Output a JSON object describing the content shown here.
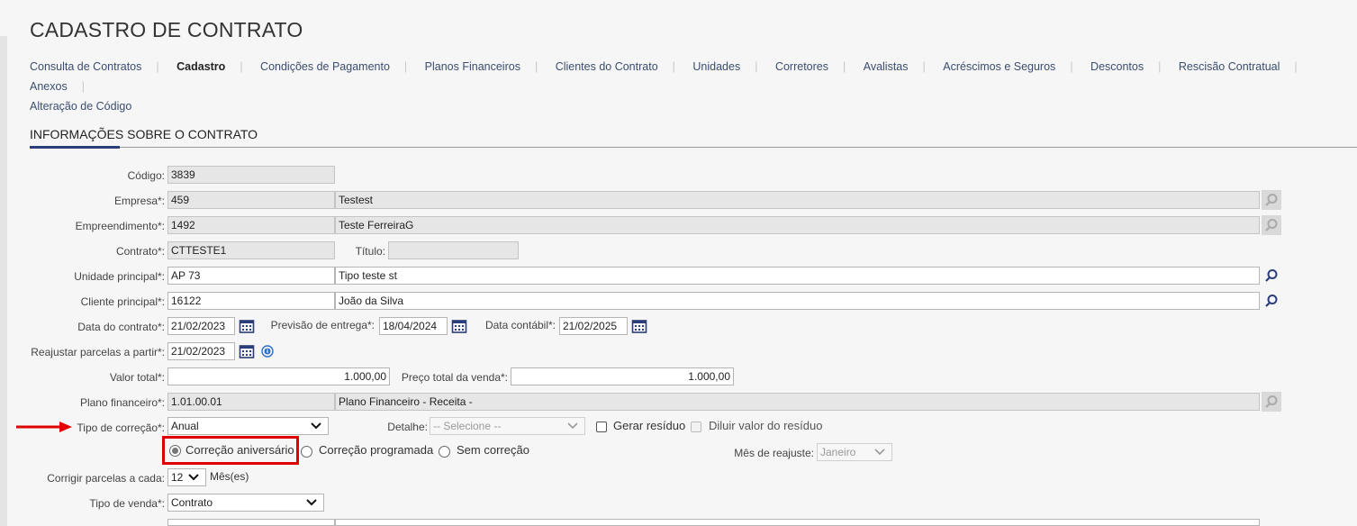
{
  "page": {
    "title": "CADASTRO DE CONTRATO"
  },
  "tabs": [
    {
      "label": "Consulta de Contratos",
      "active": false
    },
    {
      "label": "Cadastro",
      "active": true
    },
    {
      "label": "Condições de Pagamento",
      "active": false
    },
    {
      "label": "Planos Financeiros",
      "active": false
    },
    {
      "label": "Clientes do Contrato",
      "active": false
    },
    {
      "label": "Unidades",
      "active": false
    },
    {
      "label": "Corretores",
      "active": false
    },
    {
      "label": "Avalistas",
      "active": false
    },
    {
      "label": "Acréscimos e Seguros",
      "active": false
    },
    {
      "label": "Descontos",
      "active": false
    },
    {
      "label": "Rescisão Contratual",
      "active": false
    },
    {
      "label": "Anexos",
      "active": false
    },
    {
      "label": "Alteração de Código",
      "active": false
    }
  ],
  "section": {
    "title": "INFORMAÇÕES SOBRE O CONTRATO"
  },
  "form": {
    "codigo": {
      "label": "Código:",
      "value": "3839"
    },
    "empresa": {
      "label": "Empresa*:",
      "code": "459",
      "name": "Testest"
    },
    "empreendimento": {
      "label": "Empreendimento*:",
      "code": "1492",
      "name": "Teste FerreiraG"
    },
    "contrato": {
      "label": "Contrato*:",
      "value": "CTTESTE1"
    },
    "titulo": {
      "label": "Título:",
      "value": ""
    },
    "unidade": {
      "label": "Unidade principal*:",
      "code": "AP 73",
      "name": "Tipo teste st"
    },
    "cliente": {
      "label": "Cliente principal*:",
      "code": "16122",
      "name": "João da Silva"
    },
    "data_contrato": {
      "label": "Data do contrato*:",
      "value": "21/02/2023"
    },
    "previsao_entrega": {
      "label": "Previsão de entrega*:",
      "value": "18/04/2024"
    },
    "data_contabil": {
      "label": "Data contábil*:",
      "value": "21/02/2025"
    },
    "reajustar": {
      "label": "Reajustar parcelas a partir*:",
      "value": "21/02/2023"
    },
    "valor_total": {
      "label": "Valor total*:",
      "value": "1.000,00"
    },
    "preco_total": {
      "label": "Preço total da venda*:",
      "value": "1.000,00"
    },
    "plano_financeiro": {
      "label": "Plano financeiro*:",
      "code": "1.01.00.01",
      "name": "Plano Financeiro - Receita -"
    },
    "tipo_correcao": {
      "label": "Tipo de correção*:",
      "value": "Anual"
    },
    "detalhe": {
      "label": "Detalhe:",
      "value": "-- Selecione --"
    },
    "gerar_residuo": {
      "label": "Gerar resíduo",
      "checked": false
    },
    "diluir_residuo": {
      "label": "Diluir valor do resíduo",
      "checked": false
    },
    "radios": [
      {
        "label": "Correção aniversário",
        "checked": true
      },
      {
        "label": "Correção programada",
        "checked": false
      },
      {
        "label": "Sem correção",
        "checked": false
      }
    ],
    "mes_reajuste": {
      "label": "Mês de reajuste:",
      "value": "Janeiro"
    },
    "corrigir": {
      "label": "Corrigir parcelas a cada:",
      "value": "12",
      "unit": "Mês(es)"
    },
    "tipo_venda": {
      "label": "Tipo de venda*:",
      "value": "Contrato"
    }
  },
  "colors": {
    "accent": "#2c3e7a",
    "highlight": "#e00000",
    "readonly_bg": "#e6e6e6"
  }
}
